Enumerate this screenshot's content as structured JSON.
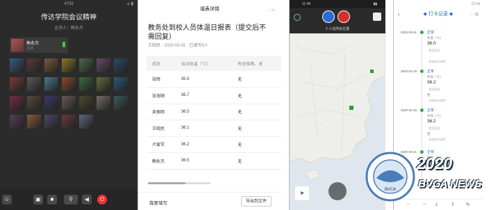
{
  "meeting": {
    "status_center": "4755",
    "title": "传达学院会议精神",
    "subtitle": "主持人：赖永杰",
    "host_name": "赖永杰",
    "host_role": "主持",
    "participants": [
      "",
      "",
      "",
      "",
      "",
      "",
      "",
      "",
      "",
      "",
      "",
      "",
      "",
      "",
      "",
      "",
      "",
      "",
      "",
      "",
      "",
      "",
      "",
      "",
      "",
      ""
    ],
    "toolbar": [
      "参会人",
      "",
      "摄像头",
      "共享",
      "静音",
      "扬声器",
      "结束"
    ]
  },
  "form": {
    "header": "填表详情",
    "title": "教务处到校人员体温日报表（提交后不需回复）",
    "meta": "王晓民 · 2020-03-02 · 已填写6人",
    "columns": [
      "成员",
      "当日体温（℃）",
      "有无咳嗽、发"
    ],
    "rows": [
      {
        "name": "张辉",
        "temp": "35.9",
        "cough": "无"
      },
      {
        "name": "张海顺",
        "temp": "36.7",
        "cough": "无"
      },
      {
        "name": "吴振刚",
        "temp": "36.5",
        "cough": "无"
      },
      {
        "name": "王晓民",
        "temp": "36.1",
        "cough": "无"
      },
      {
        "name": "卢爱军",
        "temp": "36.2",
        "cough": "无"
      },
      {
        "name": "赖永杰",
        "temp": "36.5",
        "cough": "无"
      }
    ],
    "my_entry": "我要填写",
    "export": "导出到文件"
  },
  "map": {
    "status_time": "11:49",
    "caption": "2 人在所处位置",
    "locate_icon": "➤"
  },
  "checkin": {
    "status_left": "",
    "status_right": "17:14",
    "header": "◆ 打卡记录 ◆",
    "records": [
      {
        "date": "2020-03-01",
        "state": "正常",
        "temp_label": "体温（℃）",
        "temp": "36.0",
        "n1": "· 是否离京",
        "n2": "",
        "n3": "· 其他状况说明"
      },
      {
        "date": "2020-02-29",
        "state": "正常",
        "temp_label": "体温（℃）",
        "temp": "36.2",
        "n1": "· 是否离京",
        "n2": "否",
        "n3": "· 其他状况说明"
      },
      {
        "date": "2020-02-28",
        "state": "正常",
        "temp_label": "体温（℃）",
        "temp": "36.2",
        "n1": "· 是否离京",
        "n2": "否",
        "n3": "· 其他状况说明"
      },
      {
        "date": "2020-02-21",
        "state": "正常",
        "temp_label": "体温（℃）",
        "temp": "",
        "n1": "",
        "n2": "",
        "n3": ""
      }
    ]
  },
  "watermark": {
    "year": "2020",
    "brand": "BVCA NEWS",
    "seal": "北京职业教育协会 BVCA 1999"
  }
}
